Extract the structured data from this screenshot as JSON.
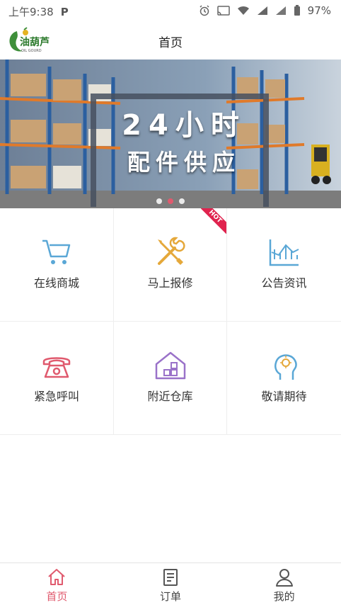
{
  "status_bar": {
    "time": "上午9:38",
    "battery": "97%"
  },
  "header": {
    "title": "首页",
    "logo_text": "油葫芦",
    "logo_sub": "OIL GOURD"
  },
  "banner": {
    "line1": "24小时",
    "line2": "配件供应",
    "slides": 3,
    "active_slide": 2
  },
  "grid": {
    "items": [
      {
        "label": "在线商城",
        "icon": "cart-icon"
      },
      {
        "label": "马上报修",
        "icon": "tools-icon",
        "badge": "HOT"
      },
      {
        "label": "公告资讯",
        "icon": "chart-icon"
      },
      {
        "label": "紧急呼叫",
        "icon": "phone-icon"
      },
      {
        "label": "附近仓库",
        "icon": "warehouse-icon"
      },
      {
        "label": "敬请期待",
        "icon": "idea-head-icon"
      }
    ]
  },
  "tabbar": {
    "items": [
      {
        "label": "首页",
        "icon": "home-icon",
        "active": true
      },
      {
        "label": "订单",
        "icon": "order-icon",
        "active": false
      },
      {
        "label": "我的",
        "icon": "user-icon",
        "active": false
      }
    ]
  },
  "colors": {
    "accent": "#e05a6e",
    "hot": "#e0234e"
  }
}
